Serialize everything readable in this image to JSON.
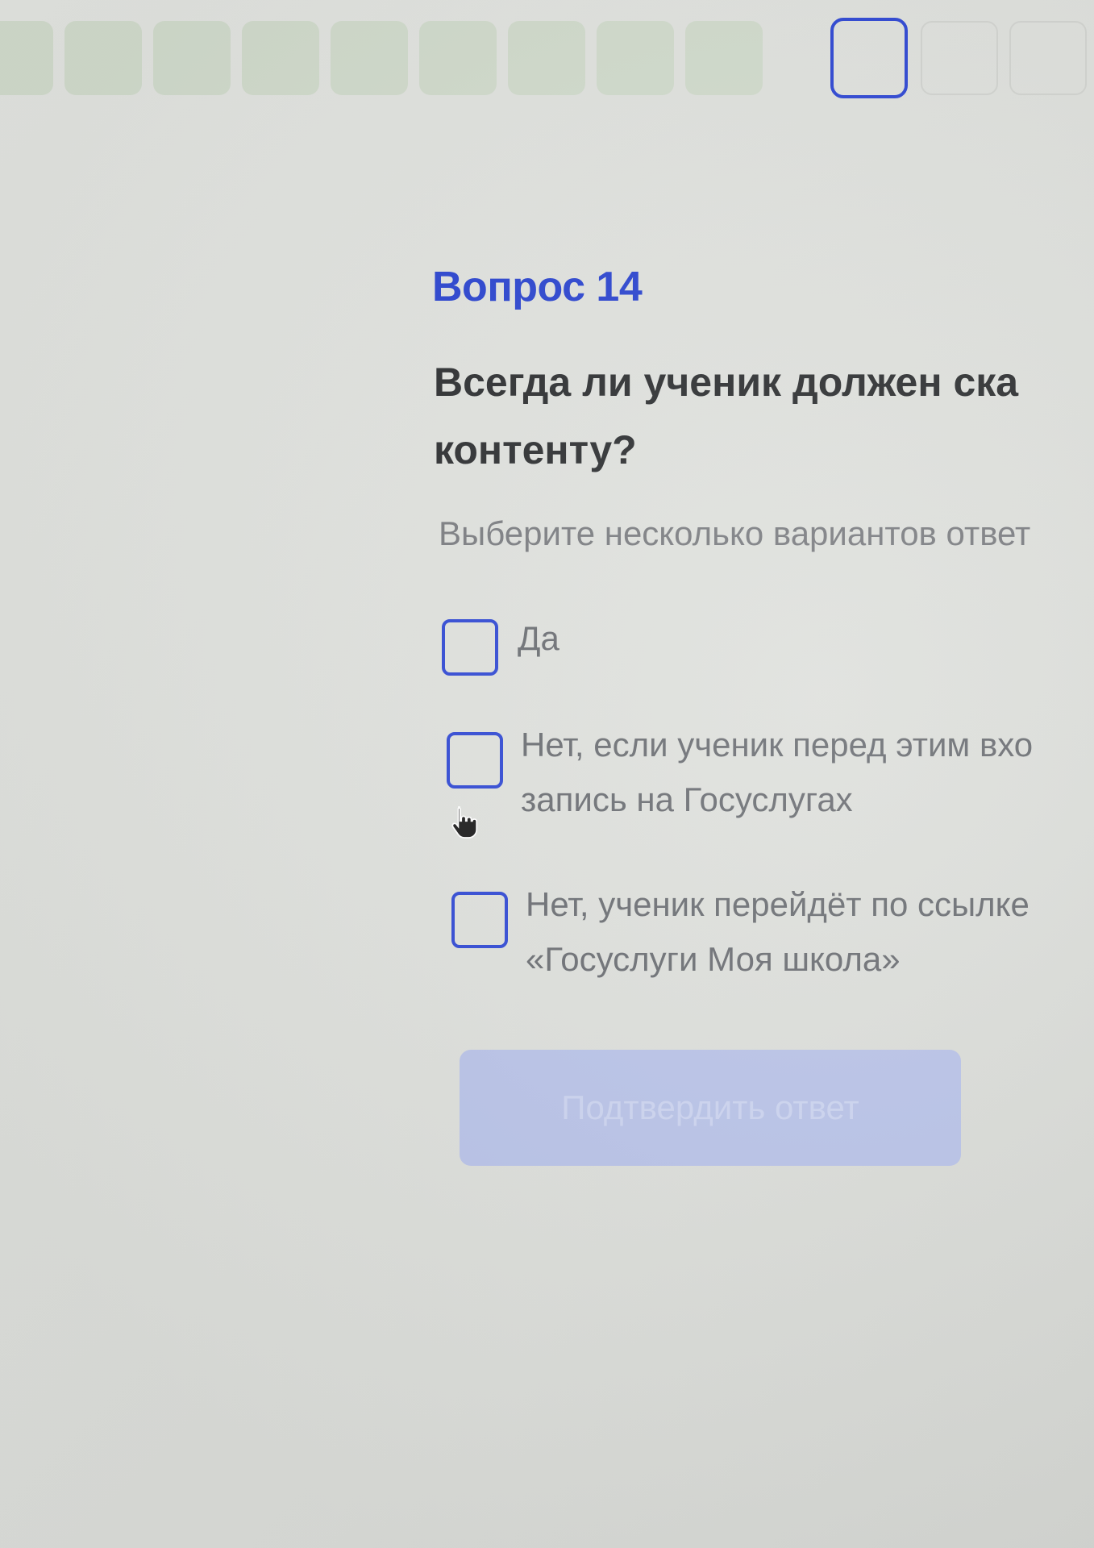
{
  "progress": {
    "done_count": 9,
    "current_index": 10,
    "todo_count": 2
  },
  "question": {
    "number_label": "Вопрос 14",
    "text_line1": "Всегда ли ученик должен ска",
    "text_line2": "контенту?",
    "hint": "Выберите несколько вариантов ответ"
  },
  "options": [
    {
      "line1": "Да",
      "line2": "",
      "checked": false
    },
    {
      "line1": "Нет, если ученик перед этим вхо",
      "line2": "запись на Госуслугах",
      "checked": false
    },
    {
      "line1": "Нет, ученик перейдёт по ссылке",
      "line2": "«Госуслуги Моя школа»",
      "checked": false
    }
  ],
  "submit": {
    "label": "Подтвердить ответ",
    "disabled": true
  },
  "colors": {
    "accent": "#2f48d4",
    "heading": "#2a44d0",
    "button_disabled_bg": "#b9c3e8"
  },
  "cursor": "hand-pointer-icon"
}
